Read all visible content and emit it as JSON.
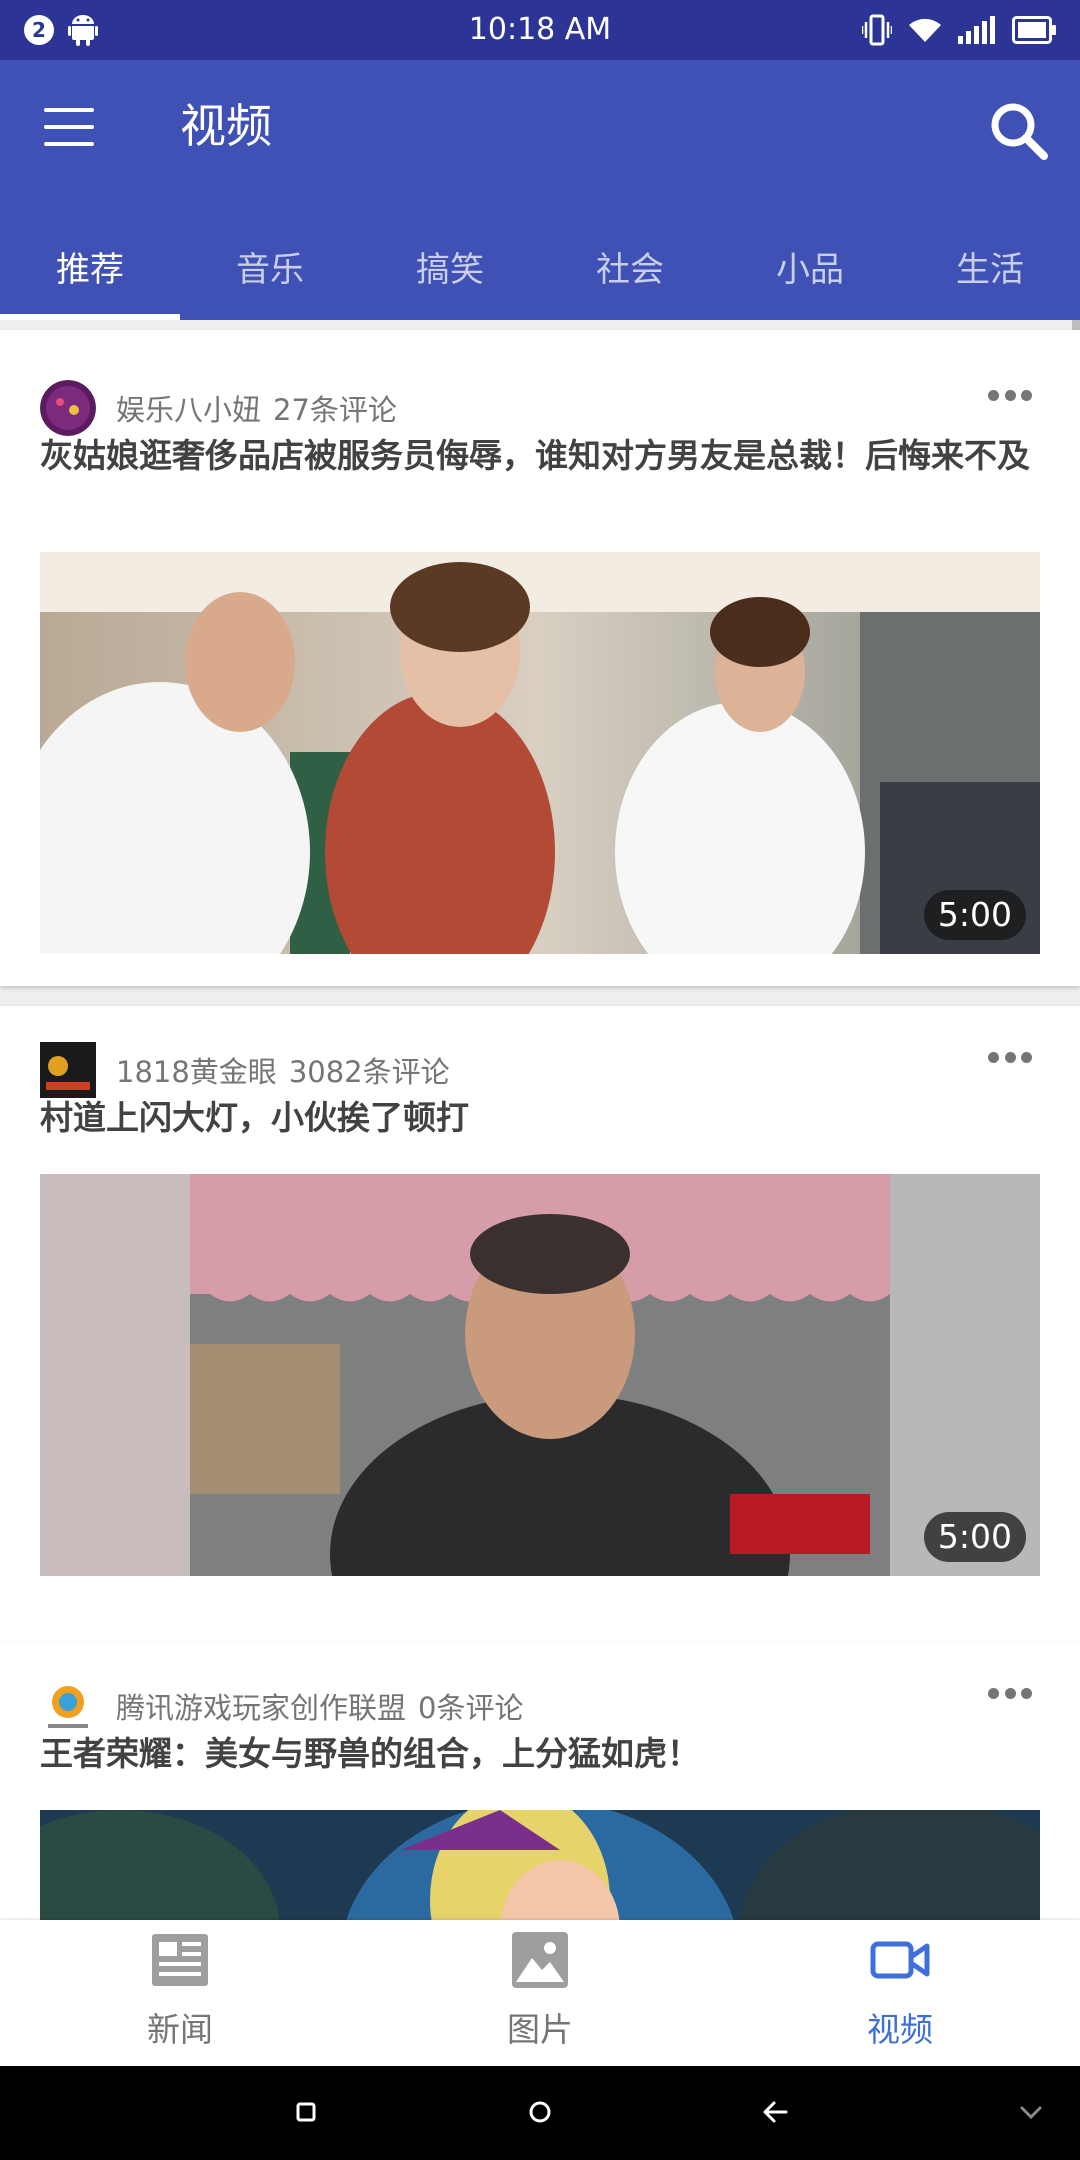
{
  "status_bar": {
    "notification_count": "2",
    "time": "10:18 AM",
    "icons": [
      "android-icon",
      "vibrate-icon",
      "wifi-icon",
      "signal-icon",
      "battery-icon"
    ]
  },
  "app_bar": {
    "title": "视频",
    "icons": [
      "menu-icon",
      "search-icon"
    ]
  },
  "tabs": [
    {
      "label": "推荐",
      "active": true
    },
    {
      "label": "音乐",
      "active": false
    },
    {
      "label": "搞笑",
      "active": false
    },
    {
      "label": "社会",
      "active": false
    },
    {
      "label": "小品",
      "active": false
    },
    {
      "label": "生活",
      "active": false
    }
  ],
  "feed": [
    {
      "source": "娱乐八小妞",
      "comments": "27条评论",
      "title": "灰姑娘逛奢侈品店被服务员侮辱，谁知对方男友是总裁！后悔来不及",
      "duration": "5:00"
    },
    {
      "source": "1818黄金眼",
      "comments": "3082条评论",
      "title": "村道上闪大灯，小伙挨了顿打",
      "duration": "5:00"
    },
    {
      "source": "腾讯游戏玩家创作联盟",
      "comments": "0条评论",
      "title": "王者荣耀：美女与野兽的组合，上分猛如虎！",
      "duration": ""
    }
  ],
  "bottom_nav": [
    {
      "label": "新闻",
      "icon": "newspaper-icon",
      "active": false
    },
    {
      "label": "图片",
      "icon": "image-icon",
      "active": false
    },
    {
      "label": "视频",
      "icon": "videocam-icon",
      "active": true
    }
  ],
  "colors": {
    "primary": "#3f51b5",
    "status_bar": "#2c3596",
    "nav_active": "#3f6fd8"
  }
}
